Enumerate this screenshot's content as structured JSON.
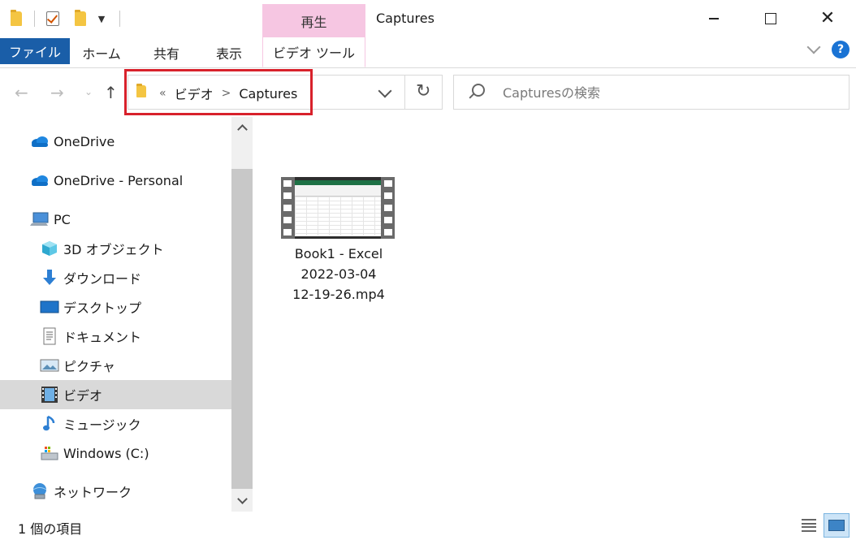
{
  "window": {
    "title": "Captures",
    "context_tab_group": "再生",
    "controls": {
      "minimize_icon": "minimize-icon",
      "maximize_icon": "maximize-icon",
      "close_icon": "close-icon"
    }
  },
  "ribbon": {
    "tabs": [
      {
        "label": "ファイル",
        "selected": true
      },
      {
        "label": "ホーム"
      },
      {
        "label": "共有"
      },
      {
        "label": "表示"
      },
      {
        "label": "ビデオ ツール"
      }
    ],
    "help_label": "?"
  },
  "address": {
    "breadcrumbs": [
      "«",
      "ビデオ",
      "Captures"
    ],
    "separator": ">",
    "highlight_color": "#d8212b"
  },
  "search": {
    "placeholder": "Capturesの検索"
  },
  "nav": {
    "items": [
      {
        "label": "OneDrive",
        "icon": "cloud-icon"
      },
      {
        "label": "OneDrive - Personal",
        "icon": "cloud-icon"
      },
      {
        "label": "PC",
        "icon": "pc-icon"
      },
      {
        "label": "3D オブジェクト",
        "icon": "cube-icon"
      },
      {
        "label": "ダウンロード",
        "icon": "download-arrow-icon"
      },
      {
        "label": "デスクトップ",
        "icon": "desktop-icon"
      },
      {
        "label": "ドキュメント",
        "icon": "document-icon"
      },
      {
        "label": "ピクチャ",
        "icon": "picture-icon"
      },
      {
        "label": "ビデオ",
        "icon": "film-icon",
        "selected": true
      },
      {
        "label": "ミュージック",
        "icon": "music-note-icon"
      },
      {
        "label": "Windows (C:)",
        "icon": "drive-icon"
      },
      {
        "label": "ネットワーク",
        "icon": "network-icon"
      }
    ]
  },
  "content": {
    "files": [
      {
        "name_lines": [
          "Book1 - Excel",
          "2022-03-04",
          "12-19-26.mp4"
        ],
        "icon": "video-thumbnail-icon"
      }
    ]
  },
  "status": {
    "item_count": "1 個の項目"
  },
  "colors": {
    "file_tab": "#1a5ea8",
    "context_tab": "#f6c6e2",
    "selected_nav": "#d9d9d9"
  }
}
